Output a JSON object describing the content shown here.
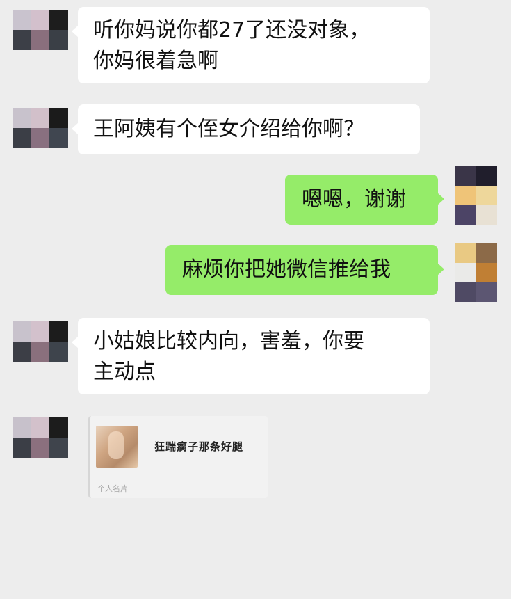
{
  "messages": [
    {
      "side": "left",
      "text": "听你妈说你都27了还没对象，\n你妈很着急啊",
      "avatar_colors": [
        "#c9c3ce",
        "#d3c0cc",
        "#1d1d1d",
        "#3c3f47",
        "#8a6f7d",
        "#3a3f46"
      ]
    },
    {
      "side": "left",
      "text": "王阿姨有个侄女介绍给你啊？",
      "avatar_colors": [
        "#c8c2cc",
        "#d2c0ca",
        "#1b1b1b",
        "#3b3e46",
        "#897080",
        "#404650"
      ]
    },
    {
      "side": "right",
      "text": "嗯嗯，谢谢",
      "avatar_colors": [
        "#3a3548",
        "#201e2c",
        "#efc478",
        "#eed79b",
        "#4c4466",
        "#e8e1d4"
      ]
    },
    {
      "side": "right",
      "text": "麻烦你把她微信推给我",
      "avatar_colors": [
        "#e9c983",
        "#8c6a48",
        "#eaeae8",
        "#c07f34",
        "#4f4a64",
        "#5c5672"
      ]
    },
    {
      "side": "left",
      "text": "小姑娘比较内向，害羞，你要\n主动点",
      "avatar_colors": [
        "#c8c2cc",
        "#d3c1cc",
        "#1c1c1c",
        "#3c3e46",
        "#8a707d",
        "#3e444c"
      ]
    }
  ],
  "card": {
    "avatar_colors": [
      "#c7c1cb",
      "#d3c1cb",
      "#1c1c1c",
      "#3b3e46",
      "#8b707e",
      "#3f444c"
    ],
    "title": "狂踹瘸子那条好腿",
    "footer": "个人名片"
  },
  "colors": {
    "background": "#ededed",
    "bubble_left": "#ffffff",
    "bubble_right": "#95ec69"
  }
}
